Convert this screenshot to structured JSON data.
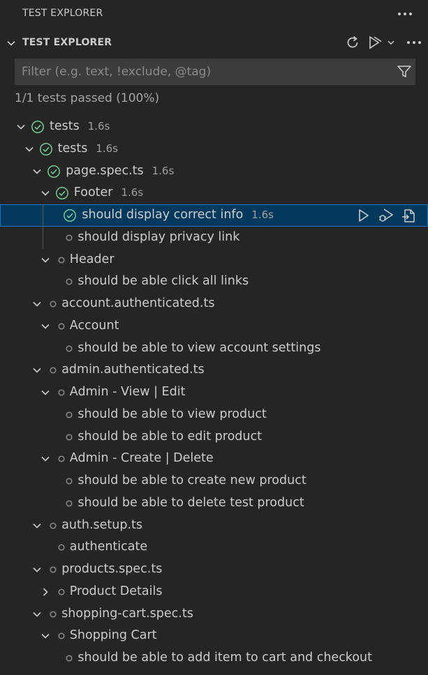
{
  "view": {
    "title": "TEST EXPLORER"
  },
  "section": {
    "title": "TEST EXPLORER"
  },
  "filter": {
    "placeholder": "Filter (e.g. text, !exclude, @tag)",
    "value": ""
  },
  "summary": "1/1 tests passed (100%)",
  "colors": {
    "passed": "#73c991",
    "pending": "#8b8b8b",
    "selection_bg": "#04395e",
    "selection_border": "#0078d4"
  },
  "tree": [
    {
      "label": "tests",
      "duration": "1.6s",
      "level": 0,
      "twisty": "expanded",
      "status": "passed"
    },
    {
      "label": "tests",
      "duration": "1.6s",
      "level": 1,
      "twisty": "expanded",
      "status": "passed"
    },
    {
      "label": "page.spec.ts",
      "duration": "1.6s",
      "level": 2,
      "twisty": "expanded",
      "status": "passed"
    },
    {
      "label": "Footer",
      "duration": "1.6s",
      "level": 3,
      "twisty": "expanded",
      "status": "passed"
    },
    {
      "label": "should display correct info",
      "duration": "1.6s",
      "level": 4,
      "twisty": "none",
      "status": "passed",
      "selected": true
    },
    {
      "label": "should display privacy link",
      "duration": "",
      "level": 4,
      "twisty": "none",
      "status": "pending"
    },
    {
      "label": "Header",
      "duration": "",
      "level": 3,
      "twisty": "expanded",
      "status": "pending"
    },
    {
      "label": "should be able click all links",
      "duration": "",
      "level": 4,
      "twisty": "none",
      "status": "pending"
    },
    {
      "label": "account.authenticated.ts",
      "duration": "",
      "level": 2,
      "twisty": "expanded",
      "status": "pending"
    },
    {
      "label": "Account",
      "duration": "",
      "level": 3,
      "twisty": "expanded",
      "status": "pending"
    },
    {
      "label": "should be able to view account settings",
      "duration": "",
      "level": 4,
      "twisty": "none",
      "status": "pending"
    },
    {
      "label": "admin.authenticated.ts",
      "duration": "",
      "level": 2,
      "twisty": "expanded",
      "status": "pending"
    },
    {
      "label": "Admin - View | Edit",
      "duration": "",
      "level": 3,
      "twisty": "expanded",
      "status": "pending"
    },
    {
      "label": "should be able to view product",
      "duration": "",
      "level": 4,
      "twisty": "none",
      "status": "pending"
    },
    {
      "label": "should be able to edit product",
      "duration": "",
      "level": 4,
      "twisty": "none",
      "status": "pending"
    },
    {
      "label": "Admin - Create | Delete",
      "duration": "",
      "level": 3,
      "twisty": "expanded",
      "status": "pending"
    },
    {
      "label": "should be able to create new product",
      "duration": "",
      "level": 4,
      "twisty": "none",
      "status": "pending"
    },
    {
      "label": "should be able to delete test product",
      "duration": "",
      "level": 4,
      "twisty": "none",
      "status": "pending"
    },
    {
      "label": "auth.setup.ts",
      "duration": "",
      "level": 2,
      "twisty": "expanded",
      "status": "pending"
    },
    {
      "label": "authenticate",
      "duration": "",
      "level": 3,
      "twisty": "none",
      "status": "pending"
    },
    {
      "label": "products.spec.ts",
      "duration": "",
      "level": 2,
      "twisty": "expanded",
      "status": "pending"
    },
    {
      "label": "Product Details",
      "duration": "",
      "level": 3,
      "twisty": "collapsed",
      "status": "pending"
    },
    {
      "label": "shopping-cart.spec.ts",
      "duration": "",
      "level": 2,
      "twisty": "expanded",
      "status": "pending"
    },
    {
      "label": "Shopping Cart",
      "duration": "",
      "level": 3,
      "twisty": "expanded",
      "status": "pending"
    },
    {
      "label": "should be able to add item to cart and checkout",
      "duration": "",
      "level": 4,
      "twisty": "none",
      "status": "pending"
    }
  ],
  "icons": {
    "more": "ellipsis-icon",
    "refresh": "refresh-icon",
    "run_all": "run-all-icon",
    "filter": "filter-icon",
    "run": "play-icon",
    "debug": "debug-icon",
    "goto": "go-to-file-icon"
  }
}
